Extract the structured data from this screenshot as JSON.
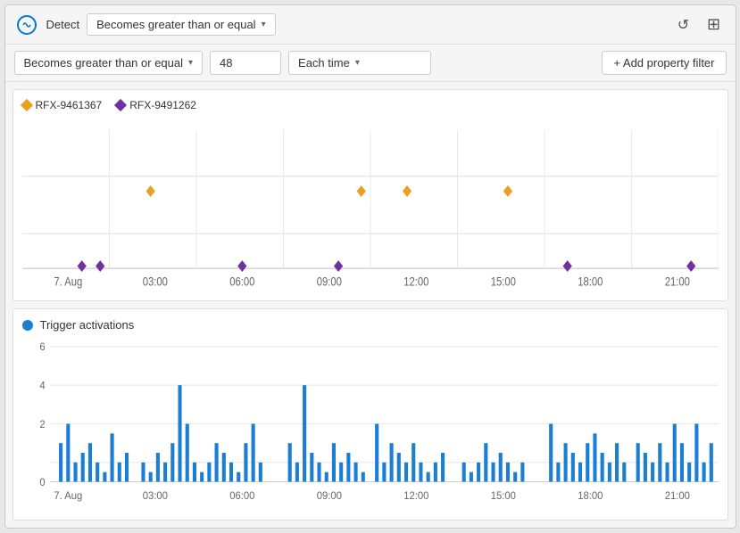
{
  "header": {
    "logo_label": "C",
    "detect_label": "Detect",
    "dropdown_label": "Becomes greater than or equal",
    "reset_icon": "↺",
    "add_icon": "+"
  },
  "filter_bar": {
    "condition_dropdown": "Becomes greater than or equal",
    "value": "48",
    "frequency_dropdown": "Each time",
    "add_filter_label": "+ Add property filter"
  },
  "scatter_chart": {
    "legend": [
      {
        "id": "rfx1",
        "label": "RFX-9461367",
        "color": "#e8a020"
      },
      {
        "id": "rfx2",
        "label": "RFX-9491262",
        "color": "#7030a0"
      }
    ],
    "x_labels": [
      "7. Aug",
      "03:00",
      "06:00",
      "09:00",
      "12:00",
      "15:00",
      "18:00",
      "21:00"
    ]
  },
  "bar_chart": {
    "title": "Trigger activations",
    "legend_color": "#1a7fd4",
    "y_labels": [
      "0",
      "2",
      "4",
      "6"
    ],
    "x_labels": [
      "7. Aug",
      "03:00",
      "06:00",
      "09:00",
      "12:00",
      "15:00",
      "18:00",
      "21:00"
    ]
  }
}
